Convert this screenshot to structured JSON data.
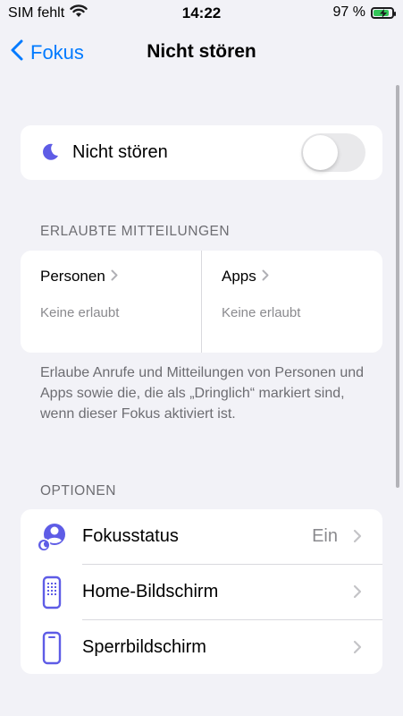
{
  "status_bar": {
    "carrier": "SIM fehlt",
    "time": "14:22",
    "battery_percent": "97 %",
    "battery_level": 0.97
  },
  "nav": {
    "back_label": "Fokus",
    "title": "Nicht stören"
  },
  "focus_toggle": {
    "label": "Nicht stören",
    "on": false
  },
  "allowed": {
    "header": "ERLAUBTE MITTEILUNGEN",
    "people": {
      "title": "Personen",
      "subtitle": "Keine erlaubt"
    },
    "apps": {
      "title": "Apps",
      "subtitle": "Keine erlaubt"
    },
    "footer": "Erlaube Anrufe und Mitteilungen von Personen und Apps sowie die, die als „Dringlich“ markiert sind, wenn dieser Fokus aktiviert ist."
  },
  "options": {
    "header": "OPTIONEN",
    "items": [
      {
        "label": "Fokusstatus",
        "value": "Ein",
        "icon": "focus-status-icon"
      },
      {
        "label": "Home-Bildschirm",
        "value": "",
        "icon": "home-screen-icon"
      },
      {
        "label": "Sperrbildschirm",
        "value": "",
        "icon": "lock-screen-icon"
      }
    ]
  },
  "colors": {
    "accent": "#007aff",
    "focus_purple": "#5e5ce6",
    "background": "#f2f2f7",
    "battery_green": "#34c759"
  }
}
